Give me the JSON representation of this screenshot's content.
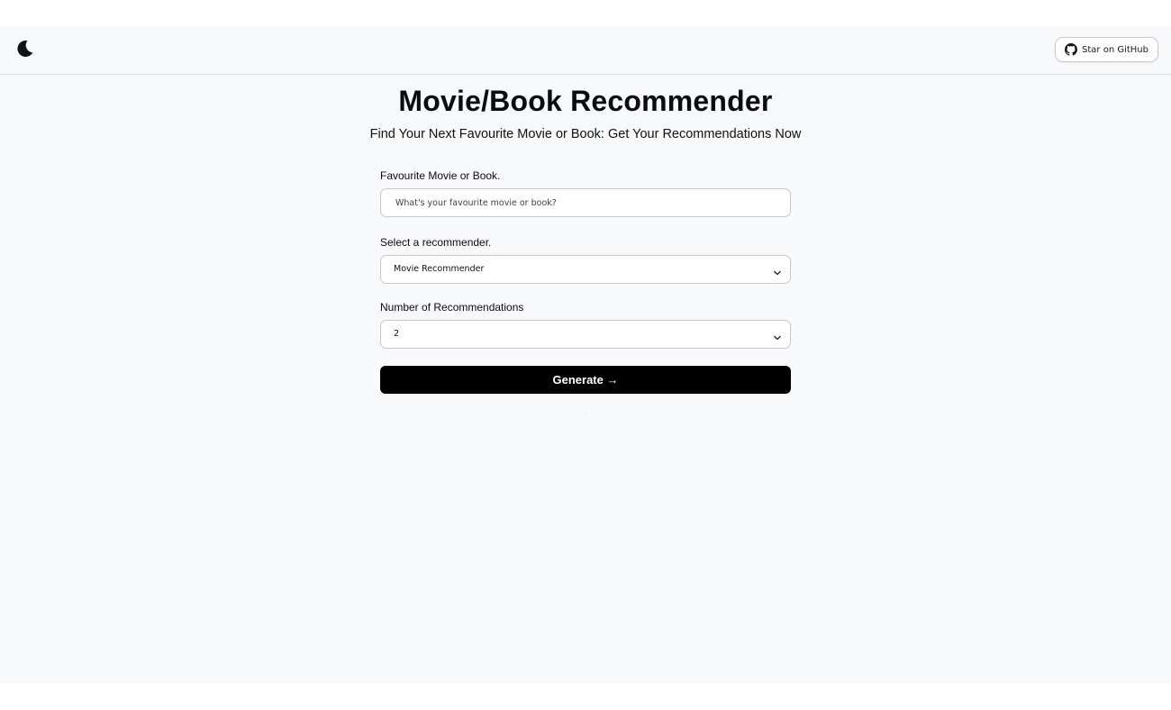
{
  "header": {
    "theme_toggle_icon": "moon-icon",
    "github_icon": "github-icon",
    "github_label": "Star on GitHub"
  },
  "main": {
    "title": "Movie/Book Recommender",
    "subtitle": "Find Your Next Favourite Movie or Book: Get Your Recommendations Now"
  },
  "form": {
    "favourite_label": "Favourite Movie or Book.",
    "favourite_value": "",
    "favourite_placeholder": "What's your favourite movie or book?",
    "recommender_label": "Select a recommender.",
    "recommender_selected": "Movie Recommender",
    "count_label": "Number of Recommendations",
    "count_selected": "2",
    "generate_label": "Generate →"
  },
  "colors": {
    "page_bg": "#f8f9fa",
    "button_bg": "#000000",
    "button_text": "#ffffff",
    "border": "#c6c7cc"
  }
}
